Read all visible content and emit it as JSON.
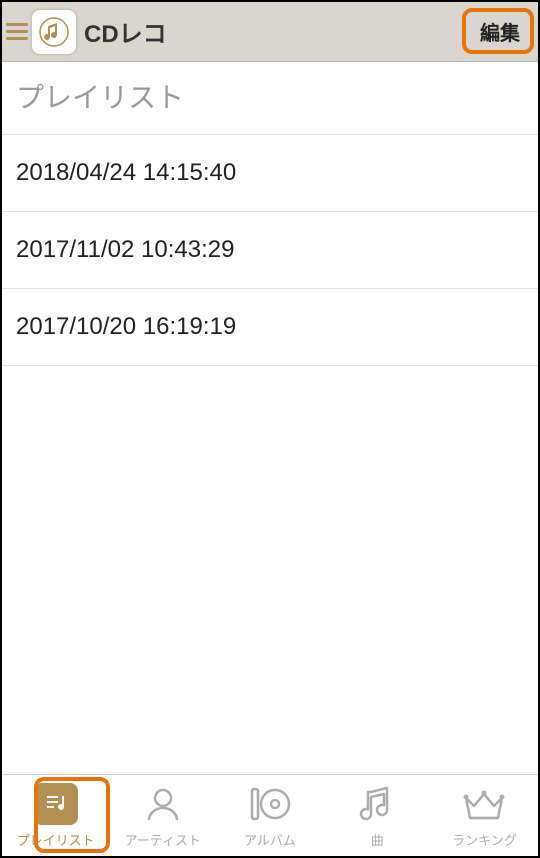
{
  "header": {
    "app_title": "CDレコ",
    "edit_label": "編集"
  },
  "section": {
    "title": "プレイリスト"
  },
  "playlists": [
    {
      "name": "2018/04/24 14:15:40"
    },
    {
      "name": "2017/11/02 10:43:29"
    },
    {
      "name": "2017/10/20 16:19:19"
    }
  ],
  "tabs": {
    "playlist": "プレイリスト",
    "artist": "アーティスト",
    "album": "アルバム",
    "song": "曲",
    "ranking": "ランキング"
  },
  "colors": {
    "accent": "#b28f52",
    "highlight": "#e8730a"
  }
}
